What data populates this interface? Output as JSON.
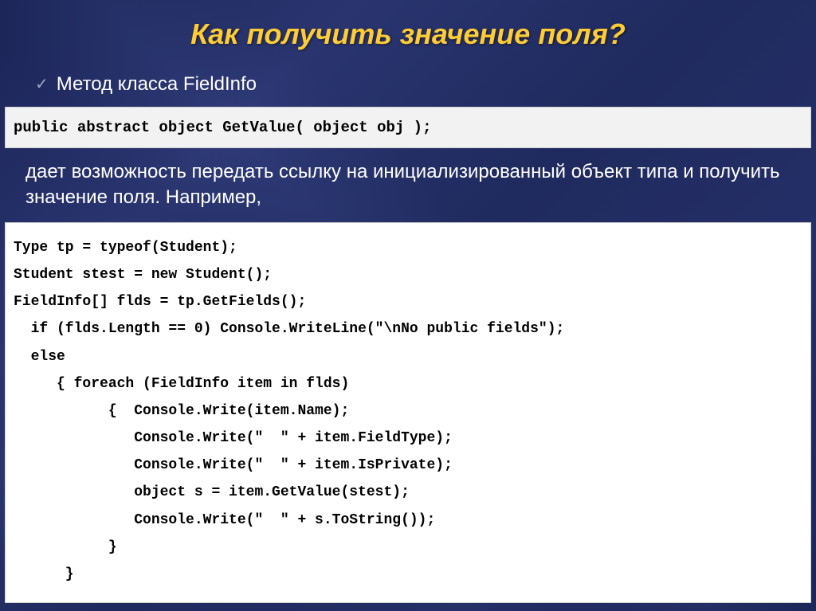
{
  "slide": {
    "title": "Как получить значение поля?",
    "bullet1": "Метод класса FieldInfo",
    "code1": "public abstract object GetValue( object obj );",
    "description": "дает возможность передать ссылку на инициализированный объект типа и получить значение поля. Например,",
    "code2": "Type tp = typeof(Student);\nStudent stest = new Student();\nFieldInfo[] flds = tp.GetFields();\n  if (flds.Length == 0) Console.WriteLine(\"\\nNo public fields\");\n  else\n     { foreach (FieldInfo item in flds)\n           {  Console.Write(item.Name);\n              Console.Write(\"  \" + item.FieldType);\n              Console.Write(\"  \" + item.IsPrivate);\n              object s = item.GetValue(stest);\n              Console.Write(\"  \" + s.ToString());\n           }\n      }"
  }
}
